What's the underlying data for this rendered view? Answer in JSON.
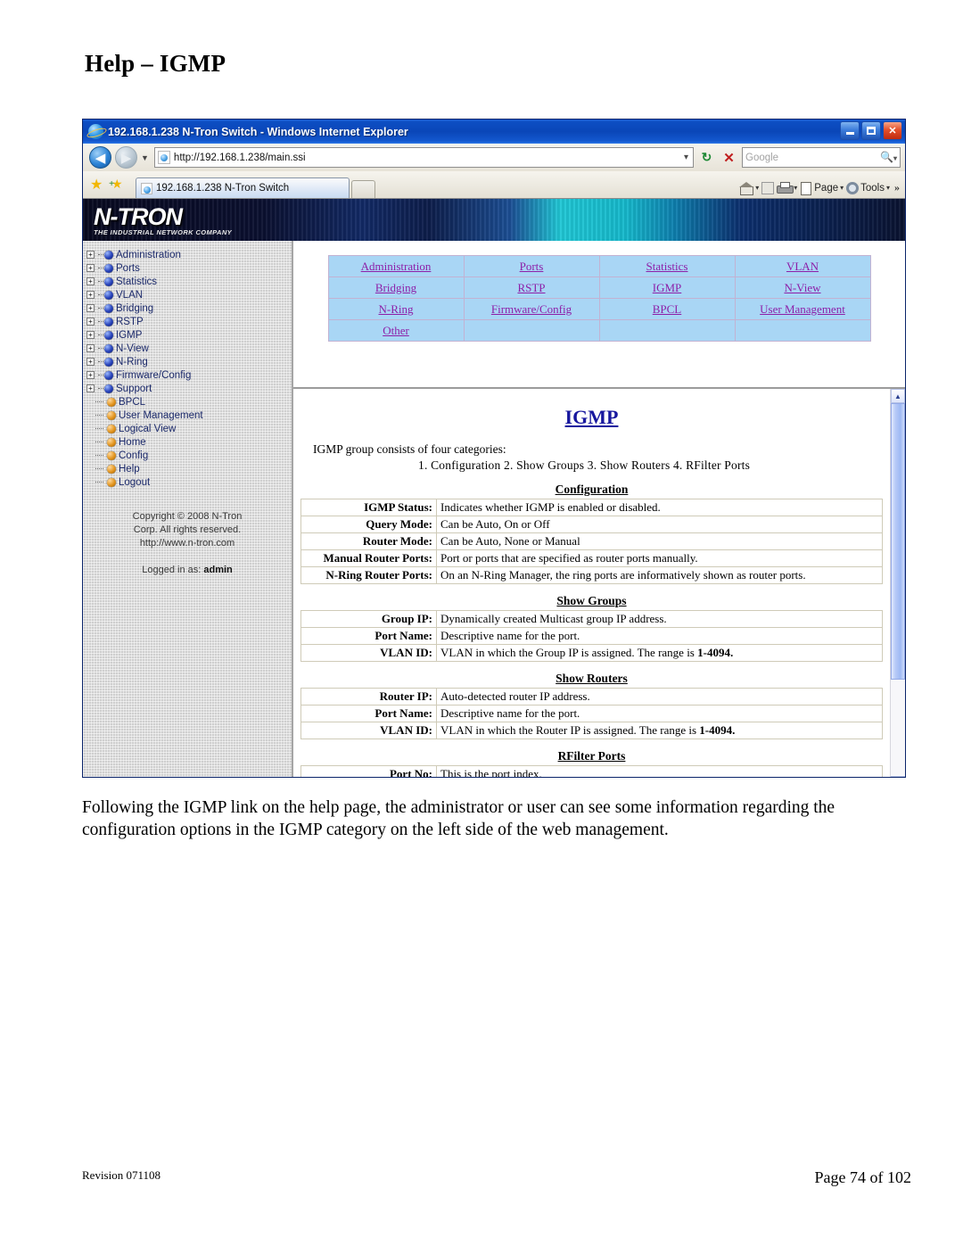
{
  "document": {
    "title": "Help – IGMP",
    "paragraph": "Following the IGMP link on the help page, the administrator or user can see some information regarding the configuration options in the IGMP category on the left side of the web management.",
    "footer": {
      "revision": "Revision 071108",
      "page": "Page 74 of 102"
    }
  },
  "browser": {
    "window_title": "192.168.1.238 N-Tron Switch - Windows Internet Explorer",
    "window_buttons": {
      "minimize": "_",
      "maximize": "□",
      "close": "✕"
    },
    "address": {
      "url": "http://192.168.1.238/main.ssi",
      "dropdown_caret": "▾",
      "refresh": "↻",
      "stop": "✕"
    },
    "search": {
      "placeholder": "Google",
      "icon": "search-icon",
      "caret": "▾"
    },
    "tabs": [
      {
        "label": "192.168.1.238 N-Tron Switch"
      }
    ],
    "toolbar": [
      {
        "label": "",
        "icon": "home-icon",
        "caret": "▾"
      },
      {
        "label": "",
        "icon": "rss-icon",
        "caret": ""
      },
      {
        "label": "",
        "icon": "print-icon",
        "caret": "▾"
      },
      {
        "label": "Page",
        "icon": "page-icon",
        "caret": "▾"
      },
      {
        "label": "Tools",
        "icon": "gear-icon",
        "caret": "▾"
      }
    ],
    "toolbar_overflow": "»"
  },
  "site": {
    "logo": {
      "mark": "N-TRON",
      "tagline": "THE INDUSTRIAL NETWORK COMPANY"
    },
    "sidebar": {
      "expandable": [
        "Administration",
        "Ports",
        "Statistics",
        "VLAN",
        "Bridging",
        "RSTP",
        "IGMP",
        "N-View",
        "N-Ring",
        "Firmware/Config",
        "Support"
      ],
      "leaves": [
        "BPCL",
        "User Management",
        "Logical View",
        "Home",
        "Config",
        "Help",
        "Logout"
      ],
      "copyright_line1": "Copyright © 2008 N-Tron",
      "copyright_line2": "Corp. All rights reserved.",
      "copyright_line3": "http://www.n-tron.com",
      "logged_in_label": "Logged in as:",
      "logged_in_user": "admin",
      "expander_symbol": "+"
    },
    "nav_links": [
      [
        "Administration",
        "Ports",
        "Statistics",
        "VLAN"
      ],
      [
        "Bridging",
        "RSTP",
        "IGMP",
        "N-View"
      ],
      [
        "N-Ring",
        "Firmware/Config",
        "BPCL",
        "User Management"
      ],
      [
        "Other",
        "",
        "",
        ""
      ]
    ],
    "content": {
      "heading": "IGMP",
      "intro_line1": "IGMP group consists of four categories:",
      "intro_line2": "1. Configuration  2. Show Groups  3. Show Routers  4. RFilter Ports",
      "sections": [
        {
          "title": "Configuration",
          "rows": [
            {
              "key": "IGMP Status:",
              "value": "Indicates whether IGMP is enabled or disabled."
            },
            {
              "key": "Query Mode:",
              "value": "Can be Auto, On or Off"
            },
            {
              "key": "Router Mode:",
              "value": "Can be Auto, None or Manual"
            },
            {
              "key": "Manual Router Ports:",
              "value": "Port or ports that are specified as router ports manually."
            },
            {
              "key": "N-Ring Router Ports:",
              "value": "On an N-Ring Manager, the ring ports are informatively shown as router ports."
            }
          ]
        },
        {
          "title": "Show Groups",
          "rows": [
            {
              "key": "Group IP:",
              "value": "Dynamically created Multicast group IP address."
            },
            {
              "key": "Port Name:",
              "value": "Descriptive name for the port."
            },
            {
              "key": "VLAN ID:",
              "value": "VLAN in which the Group IP is assigned. The range is ",
              "value_bold": "1-4094."
            }
          ]
        },
        {
          "title": "Show Routers",
          "rows": [
            {
              "key": "Router IP:",
              "value": "Auto-detected router IP address."
            },
            {
              "key": "Port Name:",
              "value": "Descriptive name for the port."
            },
            {
              "key": "VLAN ID:",
              "value": "VLAN in which the Router IP is assigned. The range is ",
              "value_bold": "1-4094."
            }
          ]
        },
        {
          "title": "RFilter Ports",
          "rows": [
            {
              "key": "Port No:",
              "value": "This is the port index."
            }
          ]
        }
      ]
    },
    "scrollbar": {
      "up": "▲",
      "down": "▼"
    }
  },
  "colors": {
    "titlebar": "#0a46b8",
    "nav_link": "#8d1fa8",
    "nav_cell": "#a9d6f5",
    "heading": "#17179e",
    "tree_text": "#1c2a6b",
    "banner": "#0a0c2e"
  }
}
